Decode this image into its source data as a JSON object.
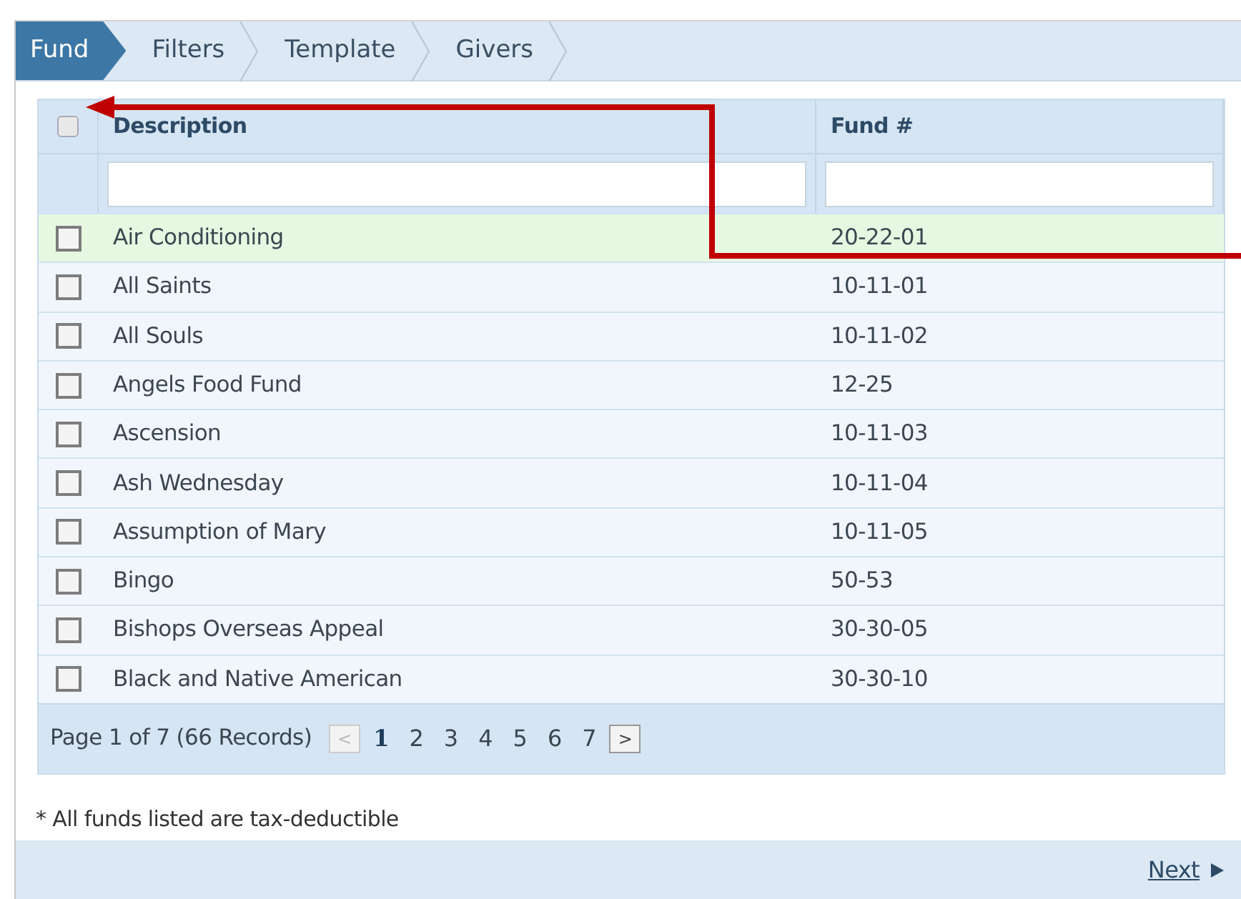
{
  "wizard_steps": [
    {
      "label": "Fund",
      "selected": true
    },
    {
      "label": "Filters",
      "selected": false
    },
    {
      "label": "Template",
      "selected": false
    },
    {
      "label": "Givers",
      "selected": false
    }
  ],
  "table": {
    "select_all": {
      "checked": false
    },
    "columns": [
      "Description",
      "Fund #"
    ],
    "rows": [
      {
        "description": "Air Conditioning",
        "fund": "20-22-01",
        "checked": false,
        "highlighted": true
      },
      {
        "description": "All Saints",
        "fund": "10-11-01",
        "checked": false,
        "highlighted": false
      },
      {
        "description": "All Souls",
        "fund": "10-11-02",
        "checked": false,
        "highlighted": false
      },
      {
        "description": "Angels Food Fund",
        "fund": "12-25",
        "checked": false,
        "highlighted": false
      },
      {
        "description": "Ascension",
        "fund": "10-11-03",
        "checked": false,
        "highlighted": false
      },
      {
        "description": "Ash Wednesday",
        "fund": "10-11-04",
        "checked": false,
        "highlighted": false
      },
      {
        "description": "Assumption of Mary",
        "fund": "10-11-05",
        "checked": false,
        "highlighted": false
      },
      {
        "description": "Bingo",
        "fund": "50-53",
        "checked": false,
        "highlighted": false
      },
      {
        "description": "Bishops Overseas Appeal",
        "fund": "30-30-05",
        "checked": false,
        "highlighted": false
      },
      {
        "description": "Black and Native American",
        "fund": "30-30-10",
        "checked": false,
        "highlighted": false
      }
    ],
    "pager": {
      "summary": "Page 1 of 7 (66 Records)",
      "prev": {
        "label": "<",
        "disabled": true
      },
      "pages": [
        {
          "label": "1",
          "selected": true
        },
        {
          "label": "2",
          "selected": false
        },
        {
          "label": "3",
          "selected": false
        },
        {
          "label": "4",
          "selected": false
        },
        {
          "label": "5",
          "selected": false
        },
        {
          "label": "6",
          "selected": false
        },
        {
          "label": "7",
          "selected": false
        }
      ],
      "next": {
        "label": ">",
        "disabled": false
      }
    }
  },
  "footnote": "* All funds listed are tax-deductible",
  "next_link": "Next"
}
